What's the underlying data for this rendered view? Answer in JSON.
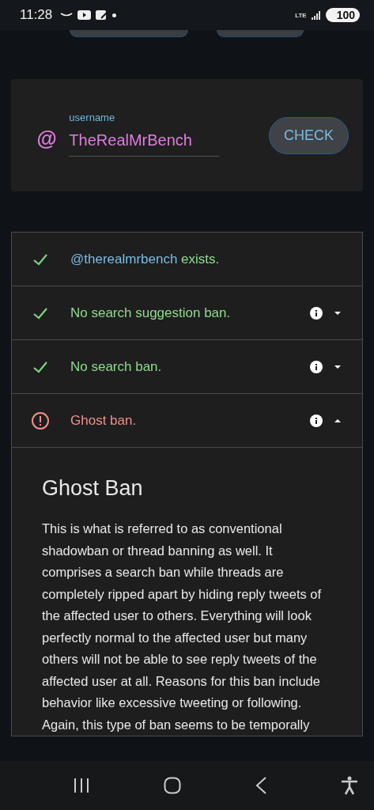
{
  "status_bar": {
    "time": "11:28",
    "network": "LTE",
    "battery": "100"
  },
  "username_card": {
    "label": "username",
    "value": "TheRealMrBench",
    "prefix": "@",
    "button": "CHECK"
  },
  "results": [
    {
      "kind": "ok",
      "handle": "@therealmrbench",
      "text": " exists.",
      "has_info": false
    },
    {
      "kind": "ok",
      "text": "No search suggestion ban.",
      "has_info": true,
      "expanded": false
    },
    {
      "kind": "ok",
      "text": "No search ban.",
      "has_info": true,
      "expanded": false
    },
    {
      "kind": "alert",
      "text": "Ghost ban.",
      "has_info": true,
      "expanded": true
    }
  ],
  "detail": {
    "title": "Ghost Ban",
    "body": "This is what is referred to as conventional shadowban or thread banning as well. It comprises a search ban while threads are completely ripped apart by hiding reply tweets of the affected user to others. Everything will look perfectly normal to the affected user but many others will not be able to see reply tweets of the affected user at all. Reasons for this ban include behavior like excessive tweeting or following. Again, this type of ban seems to be temporally"
  }
}
